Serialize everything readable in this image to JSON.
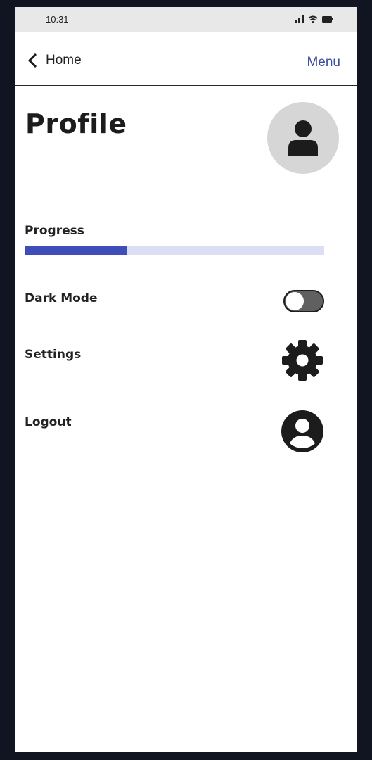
{
  "status_bar": {
    "time": "10:31",
    "icons": [
      "signal-icon",
      "wifi-icon",
      "battery-icon"
    ]
  },
  "nav": {
    "back_label": "Home",
    "back_icon": "chevron-left-icon",
    "menu_label": "Menu"
  },
  "page": {
    "title": "Profile",
    "avatar_icon": "user-icon"
  },
  "progress": {
    "label": "Progress",
    "value_fraction": 0.34
  },
  "dark_mode": {
    "label": "Dark Mode",
    "enabled": false
  },
  "settings": {
    "label": "Settings",
    "icon": "gear-icon"
  },
  "logout": {
    "label": "Logout",
    "icon": "account-circle-icon"
  },
  "colors": {
    "accent": "#3e4db8",
    "progress_track": "#dcdff3",
    "link": "#3b4aa3",
    "toggle_off": "#606060",
    "avatar_bg": "#d6d6d6"
  }
}
